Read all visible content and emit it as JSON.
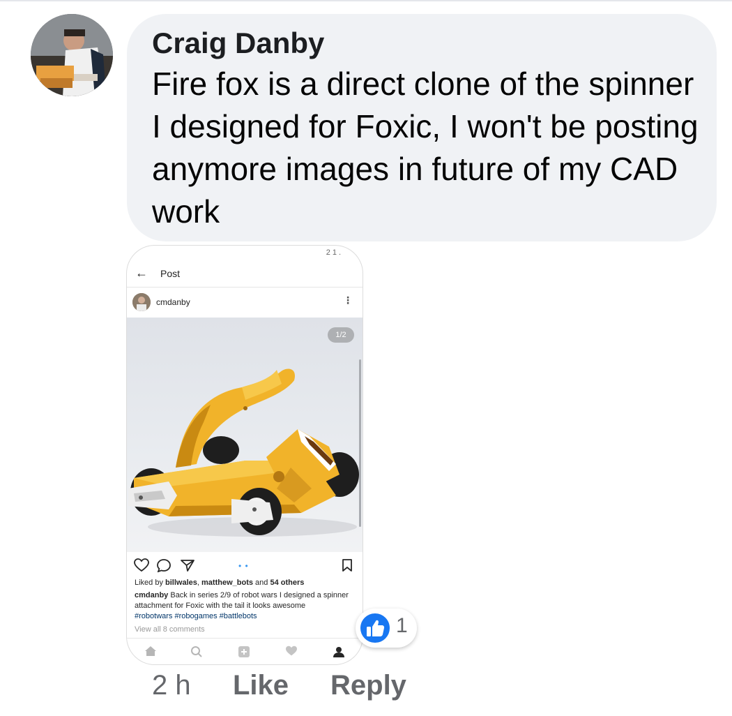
{
  "comment": {
    "author": "Craig Danby",
    "text": "Fire fox is a direct clone of the spinner I designed for Foxic, I won't be posting anymore images in future of my CAD work",
    "avatar_icon": "profile-photo"
  },
  "attachment": {
    "status_bar": "21.",
    "header_title": "Post",
    "username": "cmdanby",
    "image_counter": "1/2",
    "likes": {
      "prefix": "Liked by ",
      "user1": "billwales",
      "separator": ", ",
      "user2": "matthew_bots",
      "middle": " and ",
      "others": "54 others"
    },
    "caption_user": "cmdanby",
    "caption_text": " Back in series 2/9 of robot wars I designed a spinner attachment for Foxic with the tail it looks awesome",
    "hashtags": "#robotwars #robogames #battlebots",
    "view_comments": "View all 8 comments"
  },
  "reaction": {
    "type": "like",
    "count": "1",
    "color": "#1877f2"
  },
  "footer": {
    "time": "2 h",
    "like_label": "Like",
    "reply_label": "Reply"
  }
}
